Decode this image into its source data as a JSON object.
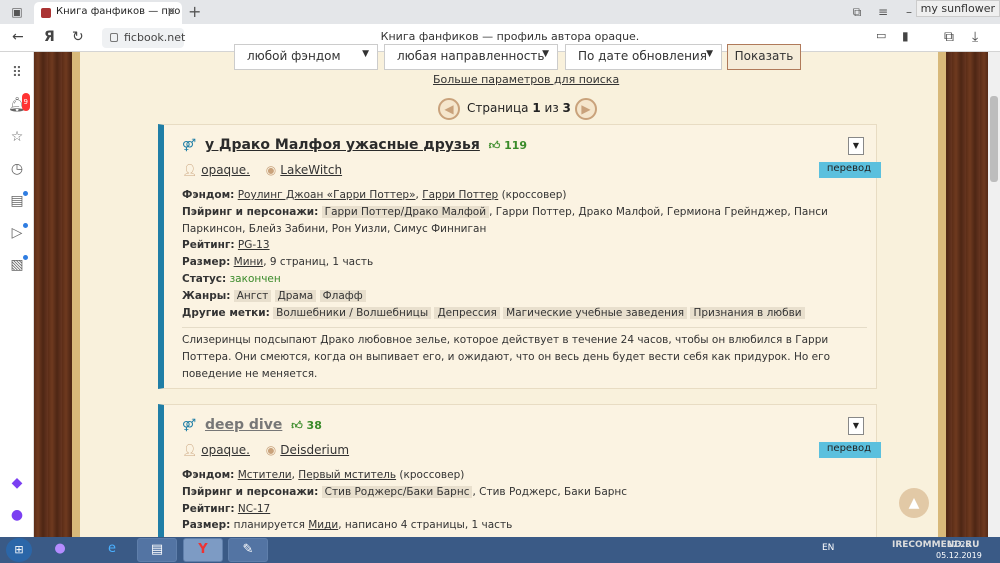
{
  "browser": {
    "tab_title": "Книга фанфиков — про",
    "address": "ficbook.net",
    "page_title": "Книга фанфиков — профиль автора opaque.",
    "user_label": "my sunflower"
  },
  "sidebar": {
    "notification_count": "9"
  },
  "filters": {
    "fandom": "любой фэндом",
    "direction": "любая направленность",
    "sort": "По дате обновления",
    "show_button": "Показать",
    "more_params": "Больше параметров для поиска"
  },
  "pager": {
    "label": "Страница",
    "current": "1",
    "of": "из",
    "total": "3"
  },
  "works": [
    {
      "title": "у Драко Малфоя ужасные друзья",
      "likes": "119",
      "author": "opaque.",
      "coauthor": "LakeWitch",
      "badge": "перевод",
      "fandom_label": "Фэндом:",
      "fandom_1": "Роулинг Джоан «Гарри Поттер»",
      "fandom_2": "Гарри Поттер",
      "fandom_suffix": "(кроссовер)",
      "pairing_label": "Пэйринг и персонажи:",
      "pairing_tag": "Гарри Поттер/Драко Малфой",
      "characters": ", Гарри Поттер, Драко Малфой, Гермиона Грейнджер, Панси Паркинсон, Блейз Забини, Рон Уизли, Симус Финниган",
      "rating_label": "Рейтинг:",
      "rating": "PG-13",
      "size_label": "Размер:",
      "size_type": "Мини",
      "size_rest": ", 9 страниц, 1 часть",
      "status_label": "Статус:",
      "status": "закончен",
      "genres_label": "Жанры:",
      "genres": [
        "Ангст",
        "Драма",
        "Флафф"
      ],
      "tags_label": "Другие метки:",
      "tags": [
        "Волшебники / Волшебницы",
        "Депрессия",
        "Магические учебные заведения",
        "Признания в любви"
      ],
      "description": "Слизеринцы подсыпают Драко любовное зелье, которое действует в течение 24 часов, чтобы он влюбился в Гарри Поттера. Они смеются, когда он выпивает его, и ожидают, что он весь день будет вести себя как придурок. Но его поведение не меняется."
    },
    {
      "title": "deep dive",
      "likes": "38",
      "author": "opaque.",
      "coauthor": "Deisderium",
      "badge": "перевод",
      "fandom_label": "Фэндом:",
      "fandom_1": "Мстители",
      "fandom_2": "Первый мститель",
      "fandom_suffix": "(кроссовер)",
      "pairing_label": "Пэйринг и персонажи:",
      "pairing_tag": "Стив Роджерс/Баки Барнс",
      "characters": ", Стив Роджерс, Баки Барнс",
      "rating_label": "Рейтинг:",
      "rating": "NC-17",
      "size_label": "Размер:",
      "size_pre": "планируется",
      "size_type": "Миди",
      "size_rest": ", написано 4 страницы, 1 часть"
    }
  ],
  "taskbar": {
    "lang": "EN",
    "time": "17:25",
    "date": "05.12.2019"
  },
  "watermark": "IRECOMMEND.RU",
  "colors": {
    "accent": "#1f7ea6",
    "wood": "#5b2d17",
    "paper": "#f9f1dc",
    "badge": "#5bc0de"
  }
}
